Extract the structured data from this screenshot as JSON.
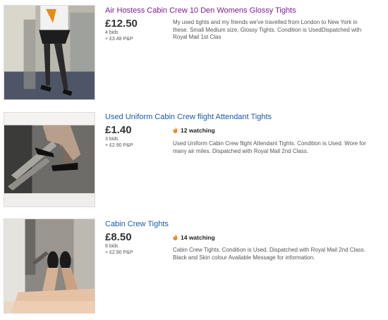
{
  "listings": [
    {
      "title": "Air Hostess Cabin Crew 10 Den Womens Glossy Tights",
      "price": "£12.50",
      "bids": "4 bids",
      "postage": "+ £3.48 P&P",
      "watching": null,
      "description": "My used tights and my friends we've travelled from London to New York in these. Small Medium size, Glossy Tights. Condition is UsedDispatched with Royal Mail 1st Clas",
      "image_icon": "listing-photo",
      "title_color": "#7b1d8f"
    },
    {
      "title": "Used Uniform Cabin Crew flight Attendant Tights",
      "price": "£1.40",
      "bids": "3 bids",
      "postage": "+ £2.90 P&P",
      "watching": "12 watching",
      "description": "Used Uniform Cabin Crew flight Attendant Tights. Condition is Used. Wore for many air miles. Dispatched with Royal Mail 2nd Class.",
      "image_icon": "listing-photo",
      "title_color": "#1a5aa8"
    },
    {
      "title": "Cabin Crew Tights",
      "price": "£8.50",
      "bids": "8 bids",
      "postage": "+ £2.90 P&P",
      "watching": "14 watching",
      "description": "Cabin Crew Tights. Condition is Used. Dispatched with Royal Mail 2nd Class. Black and Skin colour Available Message for information.",
      "image_icon": "listing-photo",
      "title_color": "#1a5aa8"
    }
  ],
  "colors": {
    "watching_flame": "#f18a1c",
    "visited_link": "#7b1d8f",
    "link": "#1a5aa8"
  }
}
